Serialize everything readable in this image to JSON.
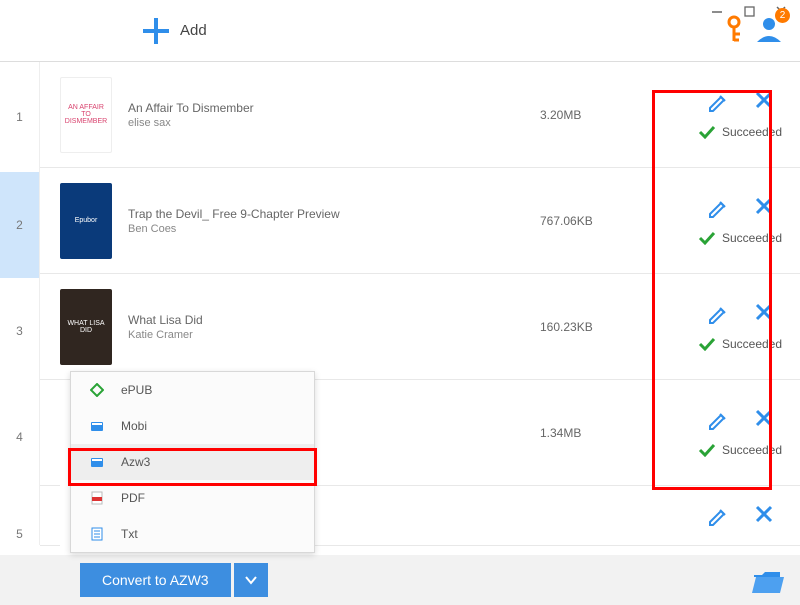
{
  "window": {
    "minimize": "–",
    "maximize": "☐",
    "close": "✕"
  },
  "toolbar": {
    "add_label": "Add",
    "user_badge": "2"
  },
  "rows": [
    {
      "index": "1",
      "title": "An Affair To Dismember",
      "author": "elise sax",
      "size": "3.20MB",
      "status": "Succeeded",
      "cover_text": "AN AFFAIR TO DISMEMBER",
      "cover_bg": "#fff",
      "cover_fg": "#d9446f"
    },
    {
      "index": "2",
      "title": "Trap the Devil_ Free 9-Chapter Preview",
      "author": "Ben Coes",
      "size": "767.06KB",
      "status": "Succeeded",
      "cover_text": "Epubor",
      "cover_bg": "#0a3a7a",
      "cover_fg": "#ffffff"
    },
    {
      "index": "3",
      "title": "What Lisa Did",
      "author": "Katie Cramer",
      "size": "160.23KB",
      "status": "Succeeded",
      "cover_text": "WHAT LISA DID",
      "cover_bg": "#302620",
      "cover_fg": "#ffffff"
    },
    {
      "index": "4",
      "title": "",
      "author": "",
      "size": "1.34MB",
      "status": "Succeeded",
      "cover_text": "",
      "cover_bg": "#ffffff",
      "cover_fg": "#ffffff"
    }
  ],
  "truncated_row": {
    "index": "5",
    "size": ""
  },
  "format_menu": [
    {
      "label": "ePUB",
      "icon": "epub",
      "color": "#2aa336"
    },
    {
      "label": "Mobi",
      "icon": "mobi",
      "color": "#2f8eea"
    },
    {
      "label": "Azw3",
      "icon": "azw3",
      "color": "#2f8eea"
    },
    {
      "label": "PDF",
      "icon": "pdf",
      "color": "#d33"
    },
    {
      "label": "Txt",
      "icon": "txt",
      "color": "#2f8eea"
    }
  ],
  "footer": {
    "convert_label": "Convert to AZW3"
  },
  "colors": {
    "accent": "#2f8eea",
    "success": "#2aa336",
    "warning": "#ff7a00"
  }
}
